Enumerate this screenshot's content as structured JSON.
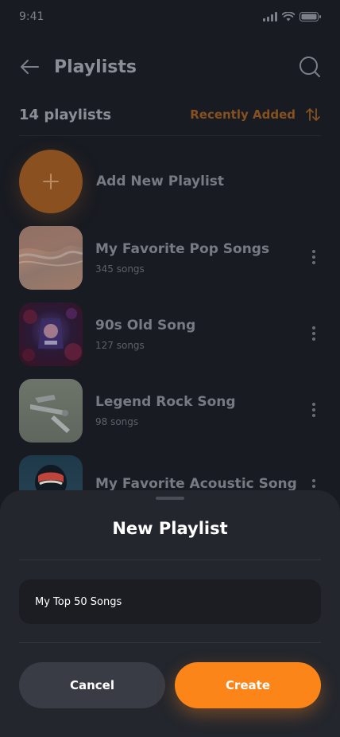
{
  "status_bar": {
    "time": "9:41"
  },
  "header": {
    "title": "Playlists"
  },
  "subheader": {
    "count_label": "14 playlists",
    "sort_label": "Recently Added"
  },
  "add_playlist": {
    "label": "Add New Playlist"
  },
  "playlists": [
    {
      "name": "My Favorite Pop Songs",
      "count": "345 songs"
    },
    {
      "name": "90s Old Song",
      "count": "127 songs"
    },
    {
      "name": "Legend Rock Song",
      "count": "98 songs"
    },
    {
      "name": "My Favorite Acoustic Song",
      "count": ""
    }
  ],
  "sheet": {
    "title": "New Playlist",
    "input_value": "My Top 50 Songs",
    "cancel_label": "Cancel",
    "create_label": "Create"
  },
  "colors": {
    "accent": "#fb8519",
    "background": "#181b22",
    "sheet": "#23262d"
  }
}
